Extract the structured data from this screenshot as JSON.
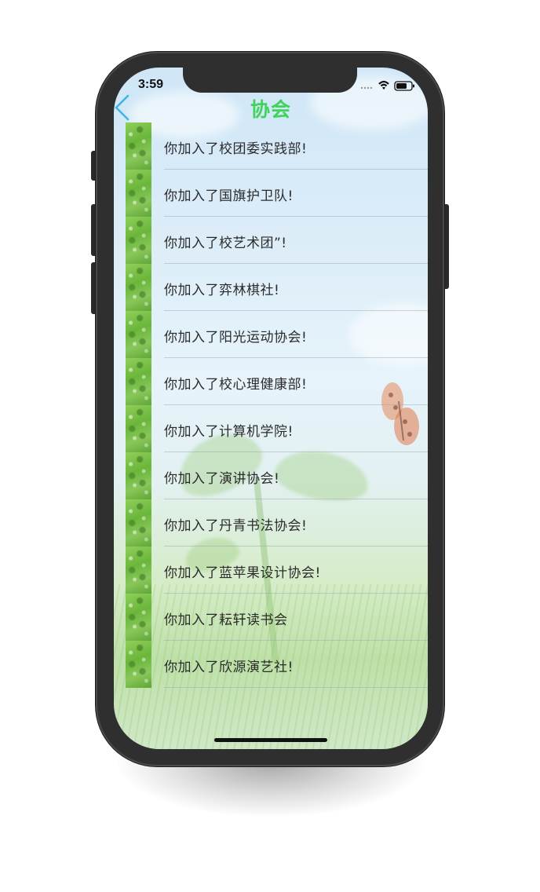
{
  "status_bar": {
    "time": "3:59"
  },
  "nav": {
    "title": "协会",
    "back_icon": "chevron-left-icon",
    "title_color": "#3fd35a",
    "accent_color": "#3fb4e0"
  },
  "list": {
    "items": [
      {
        "label": "你加入了校团委实践部!"
      },
      {
        "label": "你加入了国旗护卫队!"
      },
      {
        "label": "你加入了校艺术团”!"
      },
      {
        "label": "你加入了弈林棋社!"
      },
      {
        "label": "你加入了阳光运动协会!"
      },
      {
        "label": "你加入了校心理健康部!"
      },
      {
        "label": "你加入了计算机学院!"
      },
      {
        "label": "你加入了演讲协会!"
      },
      {
        "label": "你加入了丹青书法协会!"
      },
      {
        "label": "你加入了蓝苹果设计协会!"
      },
      {
        "label": "你加入了耘轩读书会"
      },
      {
        "label": "你加入了欣源演艺社!"
      }
    ]
  }
}
